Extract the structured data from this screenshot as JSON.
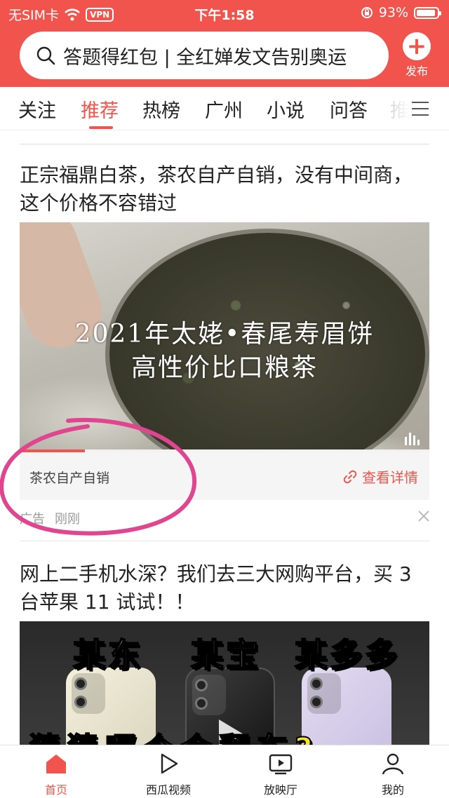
{
  "status_bar": {
    "carrier": "无SIM卡",
    "vpn": "VPN",
    "time": "下午1:58",
    "battery": "93%",
    "battery_level": 0.93
  },
  "search": {
    "text": "答题得红包 | 全红婵发文告别奥运",
    "icon": "search-icon"
  },
  "publish": {
    "label": "发布",
    "icon": "plus-icon"
  },
  "tabs": [
    {
      "label": "关注"
    },
    {
      "label": "推荐",
      "active": true
    },
    {
      "label": "热榜"
    },
    {
      "label": "广州"
    },
    {
      "label": "小说"
    },
    {
      "label": "问答"
    },
    {
      "label": "推"
    }
  ],
  "feed": {
    "item1": {
      "headline": "正宗福鼎白茶，茶农自产自销，没有中间商，这个价格不容错过",
      "overlay_line1": "2021年太姥•春尾寿眉饼",
      "overlay_line2": "高性价比口粮茶",
      "progress": 0.16,
      "source": "茶农自产自销",
      "cta": "查看详情",
      "ad_label": "广告",
      "time": "刚刚",
      "annotation_color": "#e0458f"
    },
    "item2": {
      "headline": "网上二手机水深？我们去三大网购平台，买 3 台苹果 11 试试！！",
      "thumb_label1": "某东",
      "thumb_label2": "某宝",
      "thumb_label3": "某多多",
      "thumb_bottom": "猜猜哪个会翻车?"
    }
  },
  "bottom_nav": [
    {
      "label": "首页",
      "icon": "home-icon",
      "active": true
    },
    {
      "label": "西瓜视频",
      "icon": "play-icon"
    },
    {
      "label": "放映厅",
      "icon": "tv-icon"
    },
    {
      "label": "我的",
      "icon": "user-icon"
    }
  ],
  "colors": {
    "brand_red": "#f0544c",
    "annotation_pink": "#e0458f"
  }
}
